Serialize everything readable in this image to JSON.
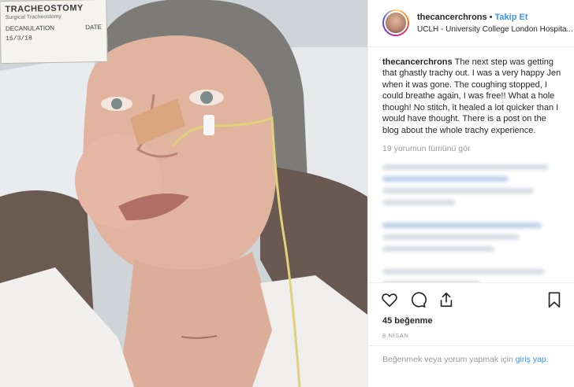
{
  "photo": {
    "chart_card": {
      "title": "TRACHEOSTOMY",
      "subtitle": "Surgical Tracheostomy",
      "left_label": "DECANULATION",
      "date": "15/3/18",
      "tag": "DATE"
    }
  },
  "header": {
    "username": "thecancerchrons",
    "separator": "•",
    "follow_label": "Takip Et",
    "location": "UCLH - University College London Hospita..."
  },
  "caption": {
    "username": "thecancerchrons",
    "text": "The next step was getting that ghastly trachy out. I was a very happy Jen when it was gone. The coughing stopped, I could breathe again, I was free!! What a hole though! No stitch, it healed a lot quicker than I would have thought. There is a post on the blog about the whole trachy experience."
  },
  "comments": {
    "view_all_label": "19 yorumun tümünü gör"
  },
  "actions": {
    "like_icon": "heart-outline-icon",
    "comment_icon": "comment-bubble-icon",
    "share_icon": "share-upload-icon",
    "save_icon": "bookmark-outline-icon"
  },
  "likes": {
    "label": "45 beğenme"
  },
  "date": {
    "label": "8 NİSAN"
  },
  "login_prompt": {
    "text": "Beğenmek veya yorum yapmak için",
    "link": "giriş yap."
  },
  "colors": {
    "link_blue": "#3897f0",
    "text": "#262626",
    "muted": "#999999",
    "border": "#efefef"
  }
}
